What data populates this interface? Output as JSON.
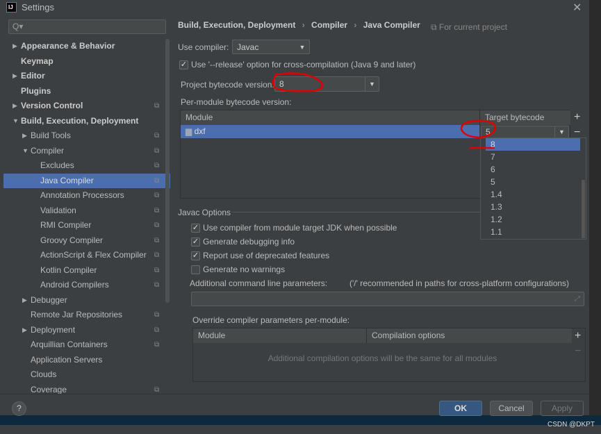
{
  "window": {
    "title": "Settings",
    "logo": "IJ",
    "close_icon": "close-icon"
  },
  "sidebar": {
    "search_placeholder": "Q▾",
    "items": [
      {
        "label": "Appearance & Behavior",
        "level": 0,
        "expandable": "collapsed",
        "bold": true,
        "copy": false
      },
      {
        "label": "Keymap",
        "level": 0,
        "expandable": "none",
        "bold": true,
        "copy": false
      },
      {
        "label": "Editor",
        "level": 0,
        "expandable": "collapsed",
        "bold": true,
        "copy": false
      },
      {
        "label": "Plugins",
        "level": 0,
        "expandable": "none",
        "bold": true,
        "copy": false
      },
      {
        "label": "Version Control",
        "level": 0,
        "expandable": "collapsed",
        "bold": true,
        "copy": true
      },
      {
        "label": "Build, Execution, Deployment",
        "level": 0,
        "expandable": "expanded",
        "bold": true,
        "copy": false
      },
      {
        "label": "Build Tools",
        "level": 1,
        "expandable": "collapsed",
        "copy": true
      },
      {
        "label": "Compiler",
        "level": 1,
        "expandable": "expanded",
        "copy": true
      },
      {
        "label": "Excludes",
        "level": 2,
        "expandable": "none",
        "copy": true
      },
      {
        "label": "Java Compiler",
        "level": 2,
        "expandable": "none",
        "copy": true,
        "selected": true
      },
      {
        "label": "Annotation Processors",
        "level": 2,
        "expandable": "none",
        "copy": true
      },
      {
        "label": "Validation",
        "level": 2,
        "expandable": "none",
        "copy": true
      },
      {
        "label": "RMI Compiler",
        "level": 2,
        "expandable": "none",
        "copy": true
      },
      {
        "label": "Groovy Compiler",
        "level": 2,
        "expandable": "none",
        "copy": true
      },
      {
        "label": "ActionScript & Flex Compiler",
        "level": 2,
        "expandable": "none",
        "copy": true
      },
      {
        "label": "Kotlin Compiler",
        "level": 2,
        "expandable": "none",
        "copy": true
      },
      {
        "label": "Android Compilers",
        "level": 2,
        "expandable": "none",
        "copy": true
      },
      {
        "label": "Debugger",
        "level": 1,
        "expandable": "collapsed",
        "copy": false
      },
      {
        "label": "Remote Jar Repositories",
        "level": 1,
        "expandable": "none",
        "copy": true
      },
      {
        "label": "Deployment",
        "level": 1,
        "expandable": "collapsed",
        "copy": true
      },
      {
        "label": "Arquillian Containers",
        "level": 1,
        "expandable": "none",
        "copy": true
      },
      {
        "label": "Application Servers",
        "level": 1,
        "expandable": "none",
        "copy": false
      },
      {
        "label": "Clouds",
        "level": 1,
        "expandable": "none",
        "copy": false
      },
      {
        "label": "Coverage",
        "level": 1,
        "expandable": "none",
        "copy": true
      }
    ]
  },
  "breadcrumb": {
    "items": [
      "Build, Execution, Deployment",
      "Compiler",
      "Java Compiler"
    ],
    "sep": "›",
    "scope": "For current project"
  },
  "compiler": {
    "use_label": "Use compiler:",
    "use_value": "Javac",
    "release_label": "Use '--release' option for cross-compilation (Java 9 and later)",
    "release_checked": true,
    "project_label": "Project bytecode version:",
    "project_value": "8",
    "per_module_label": "Per-module bytecode version:",
    "table": {
      "col_module": "Module",
      "col_target": "Target bytecode version",
      "rows": [
        {
          "module": "dxf",
          "target": "5"
        }
      ]
    },
    "dropdown_options": [
      "8",
      "7",
      "6",
      "5",
      "1.4",
      "1.3",
      "1.2",
      "1.1"
    ],
    "dropdown_highlighted": "8"
  },
  "javac": {
    "heading": "Javac Options",
    "options": [
      {
        "label": "Use compiler from module target JDK when possible",
        "checked": true
      },
      {
        "label": "Generate debugging info",
        "checked": true
      },
      {
        "label": "Report use of deprecated features",
        "checked": true
      },
      {
        "label": "Generate no warnings",
        "checked": false
      }
    ],
    "additional_label": "Additional command line parameters:",
    "additional_hint": "('/' recommended in paths for cross-platform configurations)",
    "additional_value": "",
    "override_label": "Override compiler parameters per-module:",
    "override_cols": [
      "Module",
      "Compilation options"
    ],
    "override_empty": "Additional compilation options will be the same for all modules"
  },
  "footer": {
    "help": "?",
    "ok": "OK",
    "cancel": "Cancel",
    "apply": "Apply"
  },
  "watermark": "CSDN @DKPT",
  "colors": {
    "accent": "#4b6eaf",
    "annotation": "#e00000",
    "background": "#3c3f41"
  }
}
